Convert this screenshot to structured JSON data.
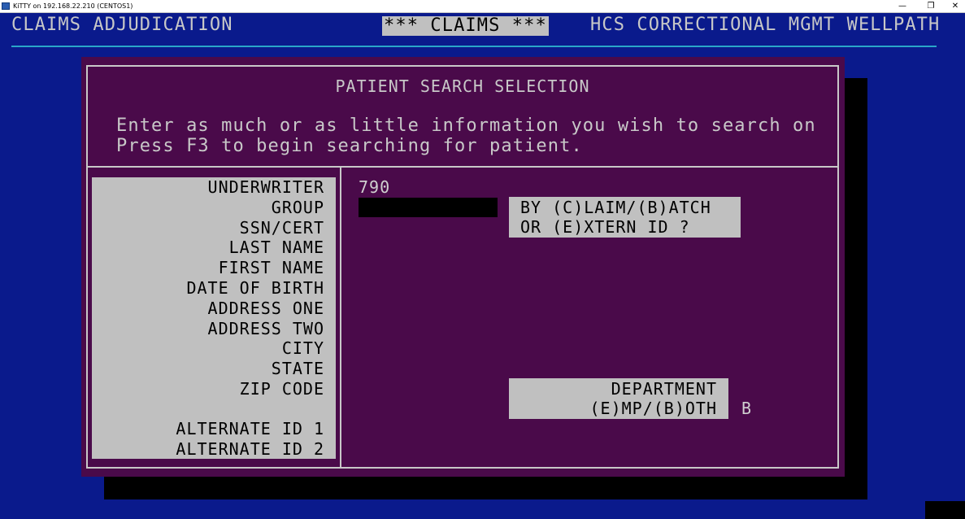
{
  "window": {
    "title": "KiTTY on 192.168.22.210 (CENTOS1)",
    "minimize": "—",
    "restore": "❐",
    "close": "✕"
  },
  "header": {
    "left": "CLAIMS ADJUDICATION",
    "center": "*** CLAIMS ***",
    "right": "HCS CORRECTIONAL MGMT WELLPATH"
  },
  "panel": {
    "title": "PATIENT SEARCH SELECTION",
    "instruction_line1": "Enter as much or as little information you wish to search on",
    "instruction_line2": "Press F3 to begin searching for patient."
  },
  "fields": [
    {
      "label": "UNDERWRITER",
      "value": "790"
    },
    {
      "label": "GROUP",
      "value": ""
    },
    {
      "label": "SSN/CERT",
      "value": ""
    },
    {
      "label": "LAST NAME",
      "value": ""
    },
    {
      "label": "FIRST NAME",
      "value": ""
    },
    {
      "label": "DATE OF BIRTH",
      "value": ""
    },
    {
      "label": "ADDRESS ONE",
      "value": ""
    },
    {
      "label": "ADDRESS TWO",
      "value": ""
    },
    {
      "label": "CITY",
      "value": ""
    },
    {
      "label": "STATE",
      "value": ""
    },
    {
      "label": "ZIP CODE",
      "value": ""
    },
    {
      "label": "ALTERNATE ID 1",
      "value": ""
    },
    {
      "label": "ALTERNATE ID 2",
      "value": ""
    }
  ],
  "claim_option": {
    "line1": "BY (C)LAIM/(B)ATCH",
    "line2": "OR (E)XTERN ID ?"
  },
  "department_option": {
    "line1": "DEPARTMENT",
    "line2": "(E)MP/(B)OTH",
    "value": "B"
  },
  "colors": {
    "terminal_bg": "#0a1a8c",
    "panel_bg": "#4a0a4a",
    "label_bg": "#c0c0c0",
    "text": "#c8c8c8",
    "header_rule": "#2aa6c8"
  }
}
